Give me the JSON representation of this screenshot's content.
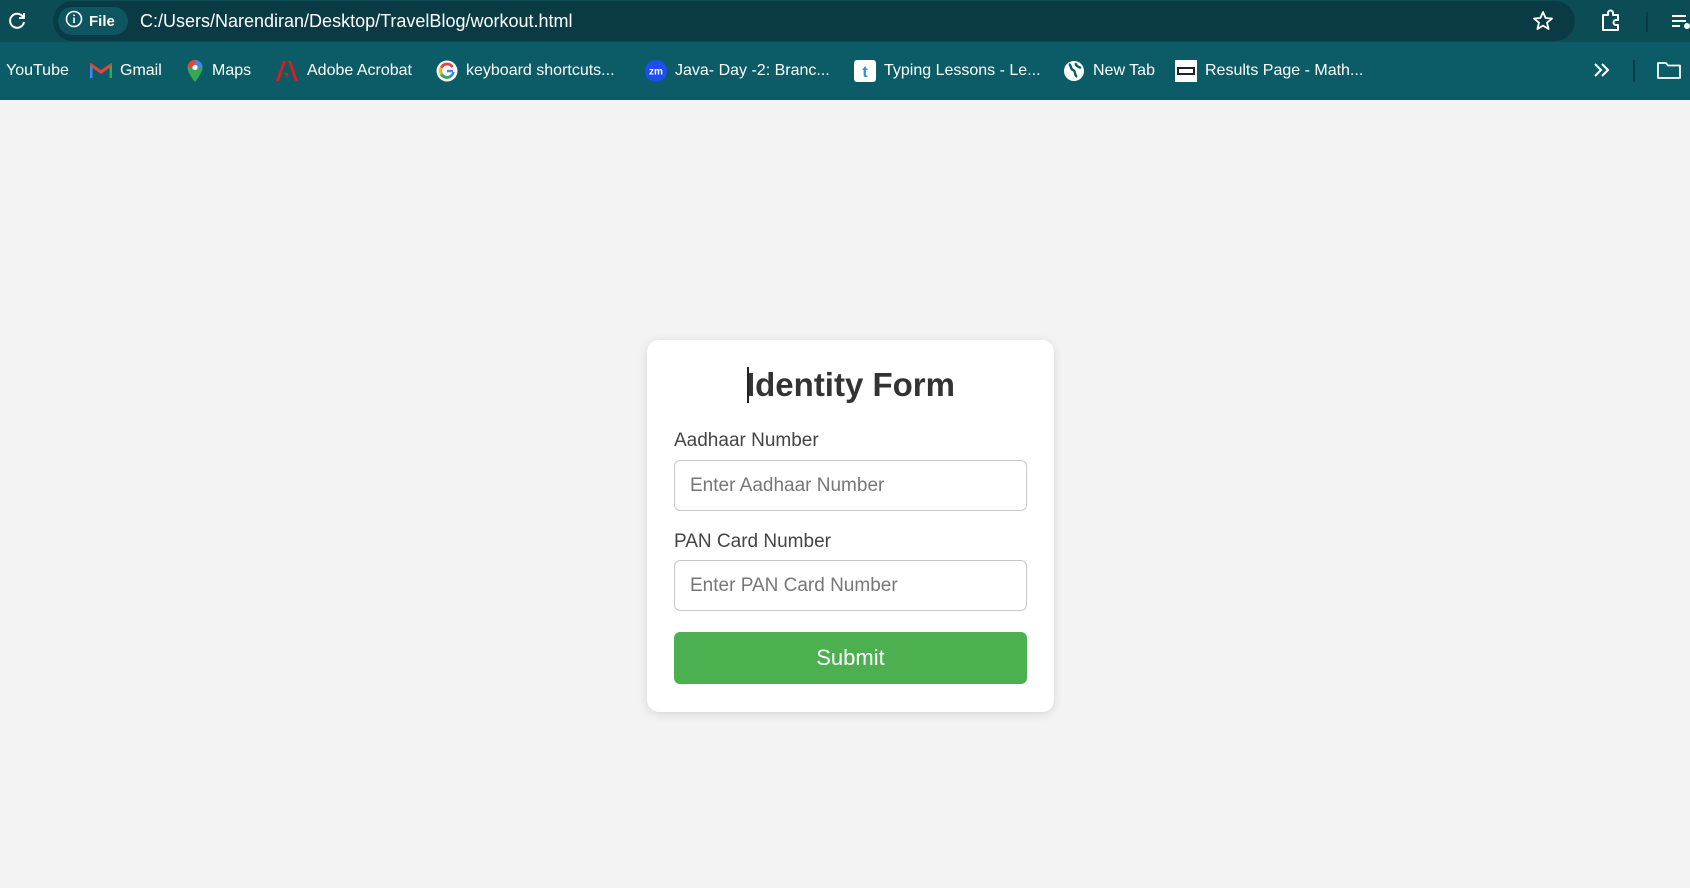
{
  "browser": {
    "site_chip_label": "File",
    "url": "C:/Users/Narendiran/Desktop/TravelBlog/workout.html",
    "icons": {
      "reload": "reload-icon",
      "site_info": "info-icon",
      "bookmark_star": "star-icon",
      "extensions": "puzzle-icon",
      "overflow": "chevron-double-right-icon",
      "folder": "folder-icon"
    },
    "colors": {
      "toolbar": "#0b4c55",
      "omnibox": "#0a3a44",
      "bookmarks_bar": "#0b5c66"
    }
  },
  "bookmarks": [
    {
      "label": "YouTube",
      "icon": "none"
    },
    {
      "label": "Gmail",
      "icon": "gmail-icon"
    },
    {
      "label": "Maps",
      "icon": "maps-pin-icon"
    },
    {
      "label": "Adobe Acrobat",
      "icon": "acrobat-icon"
    },
    {
      "label": "keyboard shortcuts...",
      "icon": "google-icon"
    },
    {
      "label": "Java- Day -2: Branc...",
      "icon": "zoom-icon"
    },
    {
      "label": "Typing Lessons - Le...",
      "icon": "typing-icon"
    },
    {
      "label": "New Tab",
      "icon": "globe-icon"
    },
    {
      "label": "Results Page - Math...",
      "icon": "results-icon"
    }
  ],
  "form": {
    "title": "Identity Form",
    "aadhaar": {
      "label": "Aadhaar Number",
      "placeholder": "Enter Aadhaar Number",
      "value": ""
    },
    "pan": {
      "label": "PAN Card Number",
      "placeholder": "Enter PAN Card Number",
      "value": ""
    },
    "submit_label": "Submit",
    "colors": {
      "page_bg": "#f3f3f3",
      "submit": "#4caf50",
      "title": "#333333"
    }
  }
}
